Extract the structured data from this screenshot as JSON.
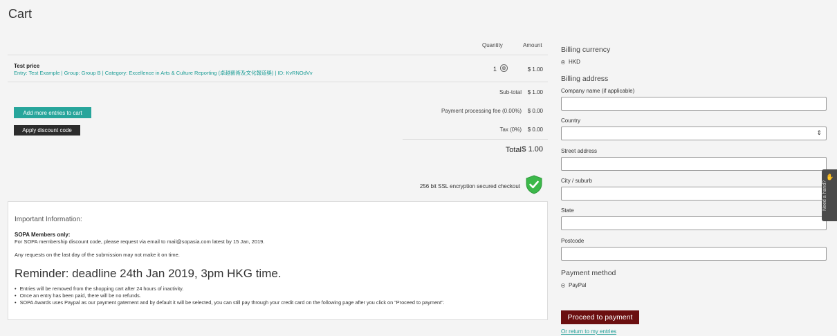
{
  "page": {
    "title": "Cart"
  },
  "cart": {
    "headers": {
      "quantity": "Quantity",
      "amount": "Amount"
    },
    "item": {
      "name": "Test price",
      "meta": "Entry: Test Example | Group: Group B | Category: Excellence in Arts & Culture Reporting (卓越藝術及文化報道獎) | ID: KvRNOdVv",
      "quantity": "1",
      "remove_glyph": "⊗",
      "amount": "$ 1.00"
    },
    "subtotal": {
      "label": "Sub-total",
      "value": "$ 1.00"
    },
    "fee": {
      "label": "Payment processing fee (0.00%)",
      "value": "$ 0.00"
    },
    "tax": {
      "label": "Tax (0%)",
      "value": "$ 0.00"
    },
    "total": {
      "label": "Total",
      "value": "$ 1.00"
    },
    "add_entries_label": "Add more entries to cart",
    "discount_label": "Apply discount code",
    "ssl_text": "256 bit SSL encryption secured checkout",
    "shield_icon": "shield-check-icon",
    "shield_color": "#3cb84a"
  },
  "info": {
    "title": "Important Information:",
    "subhead": "SOPA Members only:",
    "line1": "For SOPA membership discount code, please request via email to mail@sopasia.com latest by 15 Jan, 2019.",
    "line2": "Any requests on the last day of the submission may not make it on time.",
    "reminder": "Reminder: deadline 24th Jan 2019, 3pm HKG time.",
    "bullets": [
      "Entries will be removed from the shopping cart after 24 hours of inactivity.",
      "Once an entry has been paid, there will be no refunds.",
      "SOPA Awards uses Paypal as our payment gatement and by default it will be selected, you can still pay through your credit card on the following page after you click on \"Proceed to payment\"."
    ]
  },
  "billing": {
    "currency_heading": "Billing currency",
    "currency_option": "HKD",
    "address_heading": "Billing address",
    "fields": {
      "company": "Company name (if applicable)",
      "country": "Country",
      "street": "Street address",
      "city": "City / suburb",
      "state": "State",
      "postcode": "Postcode"
    },
    "payment_heading": "Payment method",
    "payment_option": "PayPal",
    "proceed_label": "Proceed to payment",
    "return_link": "Or return to my entries"
  },
  "help": {
    "label": "Need a hand?",
    "icon": "hand-wave-icon"
  },
  "colors": {
    "teal": "#27a59b",
    "dark": "#2c2c2c",
    "maroon": "#6b0f10"
  }
}
